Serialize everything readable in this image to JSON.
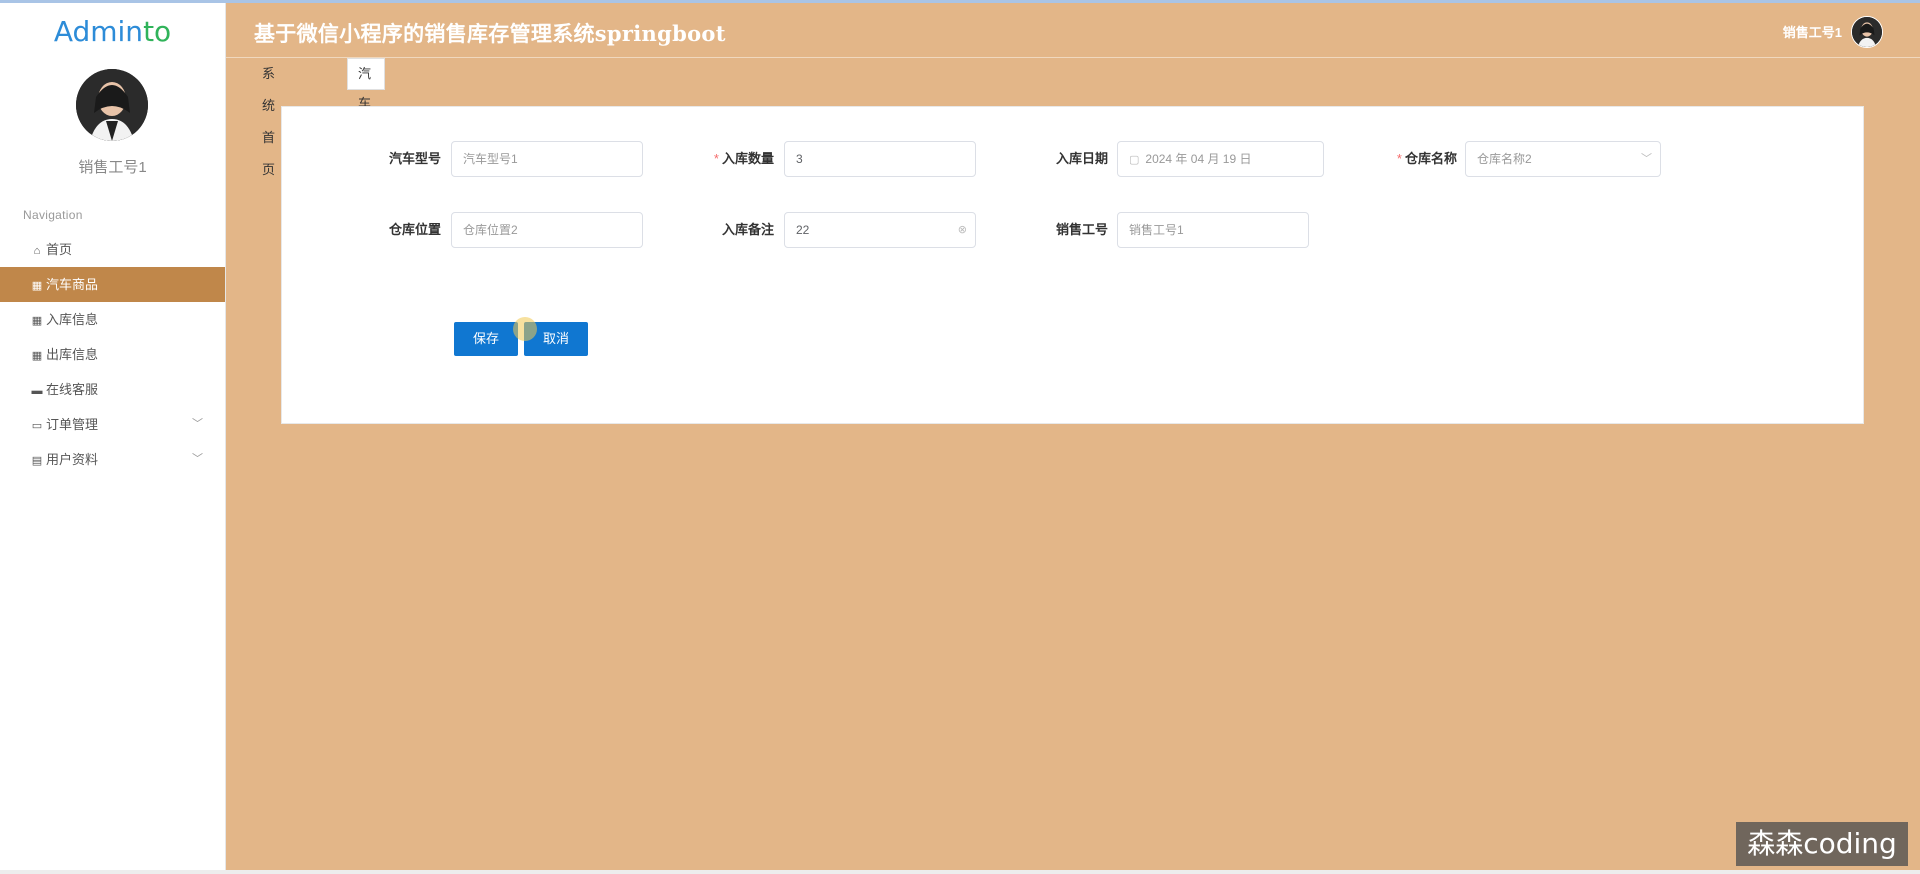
{
  "app": {
    "logo_main": "Admin",
    "logo_accent": "to",
    "title": "基于微信小程序的销售库存管理系统springboot"
  },
  "user": {
    "name": "销售工号1"
  },
  "sidebar": {
    "nav_title": "Navigation",
    "items": [
      {
        "label": "首页",
        "icon": "home-icon",
        "glyph": "⌂",
        "active": false
      },
      {
        "label": "汽车商品",
        "icon": "grid-icon",
        "glyph": "▦",
        "active": true
      },
      {
        "label": "入库信息",
        "icon": "grid-icon",
        "glyph": "▦",
        "active": false
      },
      {
        "label": "出库信息",
        "icon": "grid-icon",
        "glyph": "▦",
        "active": false
      },
      {
        "label": "在线客服",
        "icon": "briefcase-icon",
        "glyph": "▬",
        "active": false
      },
      {
        "label": "订单管理",
        "icon": "monitor-icon",
        "glyph": "▭",
        "active": false,
        "expandable": true
      },
      {
        "label": "用户资料",
        "icon": "card-icon",
        "glyph": "▤",
        "active": false,
        "expandable": true
      }
    ]
  },
  "tabs": [
    {
      "label": "系统首页",
      "active": false
    },
    {
      "label": "汽车商品",
      "active": true,
      "close": "×"
    }
  ],
  "form": {
    "model": {
      "label": "汽车型号",
      "value": "汽车型号1"
    },
    "quantity": {
      "label": "入库数量",
      "value": "3",
      "required": "*"
    },
    "date": {
      "label": "入库日期",
      "value": "2024 年 04 月 19 日"
    },
    "warehouse_name": {
      "label": "仓库名称",
      "value": "仓库名称2",
      "required": "*"
    },
    "warehouse_location": {
      "label": "仓库位置",
      "value": "仓库位置2"
    },
    "remark": {
      "label": "入库备注",
      "value": "22"
    },
    "sales_id": {
      "label": "销售工号",
      "value": "销售工号1"
    },
    "save_label": "保存",
    "cancel_label": "取消"
  },
  "watermark": "森森coding",
  "colors": {
    "background": "#e3b688",
    "active_nav": "#c0874a",
    "primary_button": "#1077d1",
    "required": "#f56c6c",
    "logo_blue": "#2d8cd8",
    "logo_green": "#30b35a"
  }
}
